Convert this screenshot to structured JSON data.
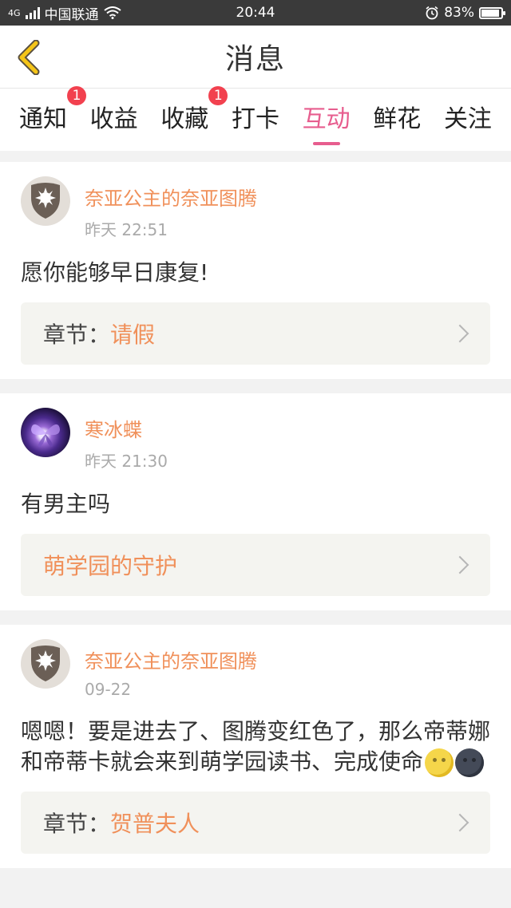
{
  "statusbar": {
    "network": "4G",
    "carrier": "中国联通",
    "time": "20:44",
    "battery": "83%",
    "battery_level": 0.83
  },
  "header": {
    "title": "消息"
  },
  "tabs": [
    {
      "label": "通知",
      "badge": "1"
    },
    {
      "label": "收益",
      "badge": ""
    },
    {
      "label": "收藏",
      "badge": "1"
    },
    {
      "label": "打卡",
      "badge": ""
    },
    {
      "label": "互动",
      "badge": "",
      "active": true
    },
    {
      "label": "鲜花",
      "badge": ""
    },
    {
      "label": "关注",
      "badge": ""
    }
  ],
  "feed": [
    {
      "avatar": "shield-avatar",
      "name": "奈亚公主的奈亚图腾",
      "time": "昨天 22:51",
      "content": "愿你能够早日康复!",
      "ref_label": "章节：",
      "ref_value": "请假"
    },
    {
      "avatar": "butterfly-avatar",
      "name": "寒冰蝶",
      "time": "昨天 21:30",
      "content": "有男主吗",
      "ref_label": "",
      "ref_value": "萌学园的守护"
    },
    {
      "avatar": "shield-avatar",
      "name": "奈亚公主的奈亚图腾",
      "time": "09-22",
      "content": "嗯嗯！要是进去了、图腾变红色了，那么帝蒂娜和帝蒂卡就会来到萌学园读书、完成使命",
      "emojis": [
        "full-moon-face-emoji",
        "new-moon-face-emoji"
      ],
      "ref_label": "章节：",
      "ref_value": "贺普夫人"
    }
  ],
  "colors": {
    "accent_pink": "#e75d8e",
    "name_orange": "#f0905a",
    "badge_red": "#f2414f",
    "back_arrow_yellow": "#f5c518"
  }
}
